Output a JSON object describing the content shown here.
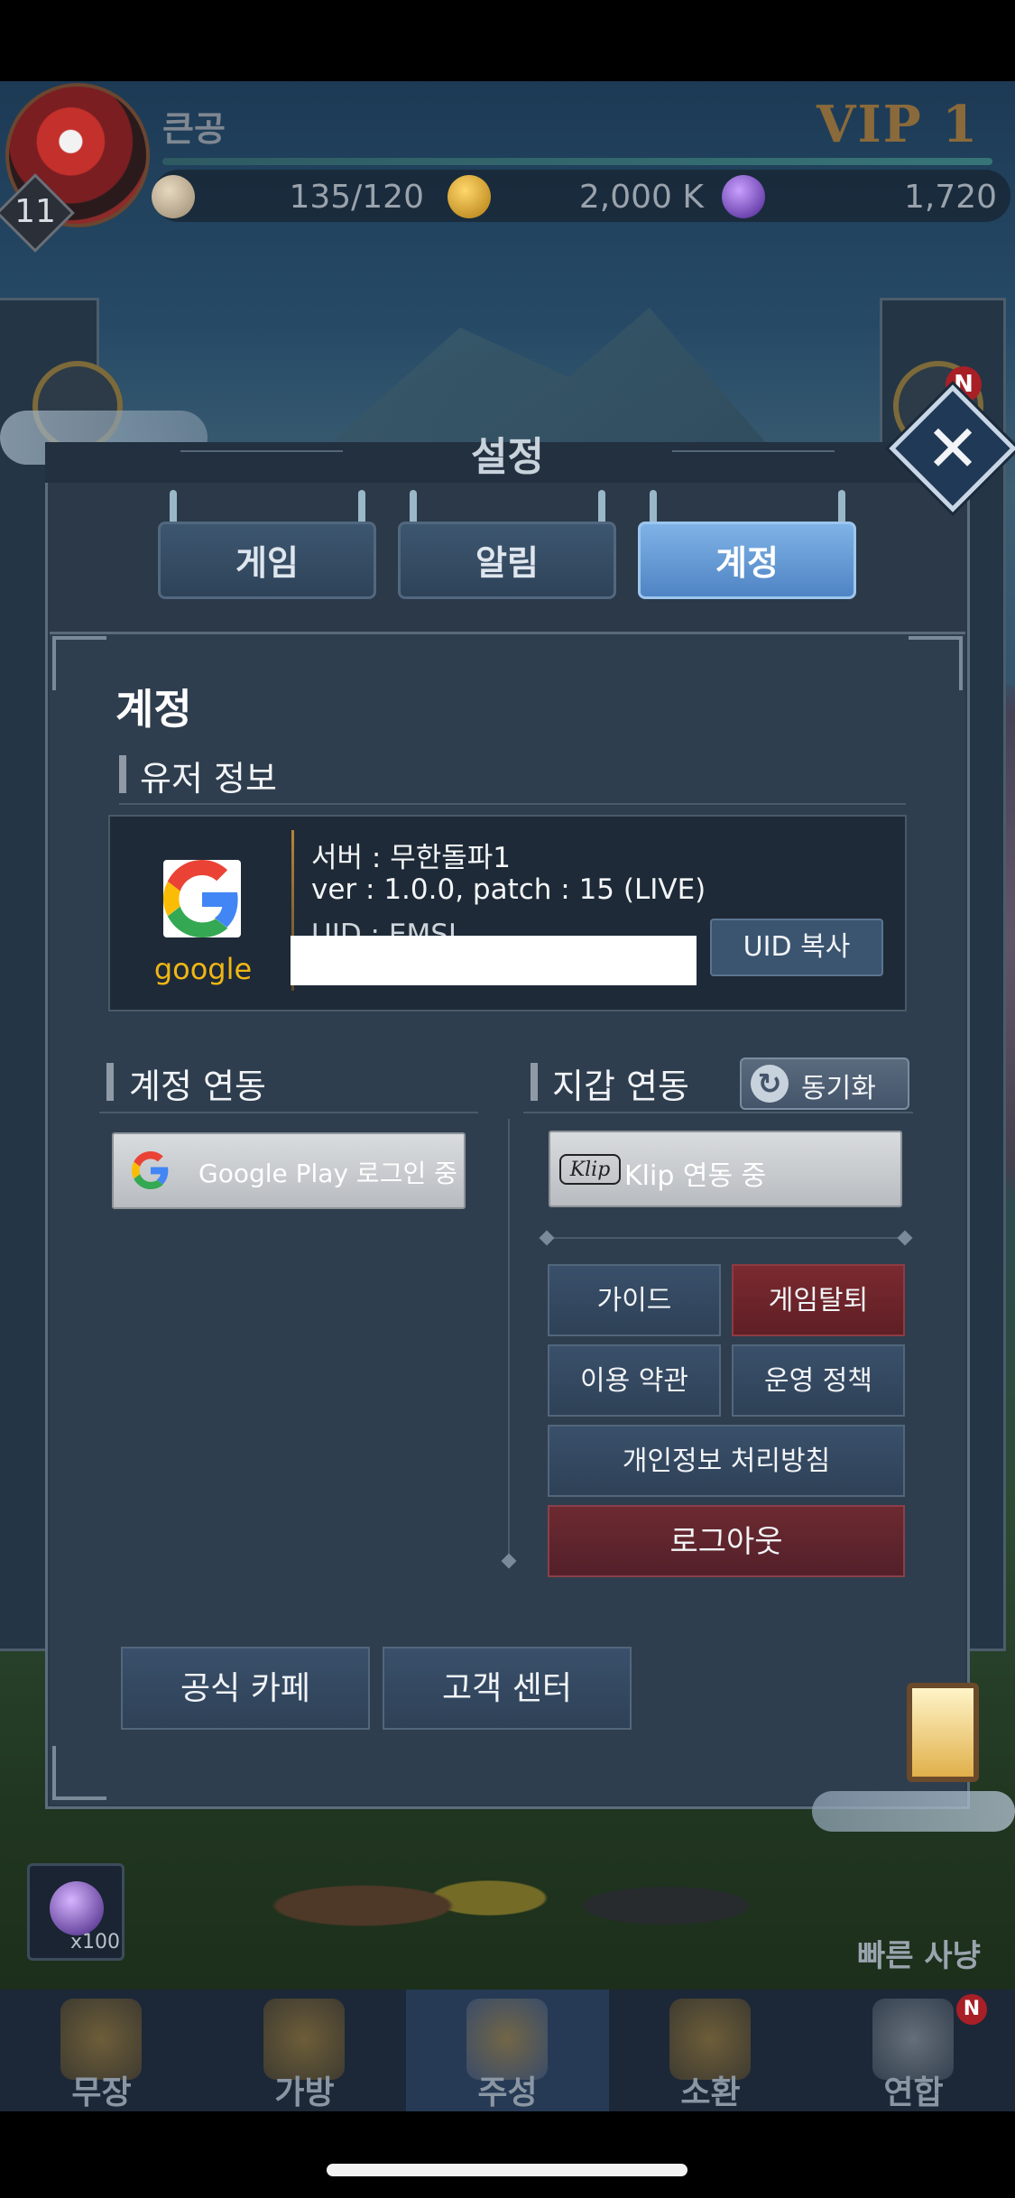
{
  "status": {
    "player_name": "큰공",
    "level": "11",
    "vip": "VIP  1",
    "stamina": "135/120",
    "gold": "2,000 K",
    "gems": "1,720"
  },
  "settings": {
    "title": "설정",
    "close_icon": "✕",
    "tabs": [
      {
        "label": "게임",
        "selected": false
      },
      {
        "label": "알림",
        "selected": false
      },
      {
        "label": "계정",
        "selected": true
      }
    ]
  },
  "account": {
    "section_title": "계정",
    "user_info_title": "유저 정보",
    "provider_label": "google",
    "server": "서버 : 무한돌파1",
    "version": "ver : 1.0.0, patch : 15 (LIVE)",
    "uid_prefix": "UID : EMSI...",
    "uid_copy_label": "UID 복사",
    "account_link_title": "계정 연동",
    "google_play_label": "Google Play 로그인 중",
    "wallet_link_title": "지갑 연동",
    "sync_label": "동기화",
    "klip_logo": "Klip",
    "klip_label": "Klip 연동 중",
    "guide_label": "가이드",
    "withdraw_label": "게임탈퇴",
    "terms_label": "이용 약관",
    "policy_label": "운영 정책",
    "privacy_label": "개인정보 처리방침",
    "logout_label": "로그아웃",
    "cafe_label": "공식 카페",
    "support_label": "고객 센터"
  },
  "game_hud": {
    "item_count": "x100",
    "quick_hunt_label": "빠른 사냥",
    "new_badge": "N"
  },
  "bottom_nav": {
    "items": [
      {
        "label": "무장",
        "icon": "general-icon"
      },
      {
        "label": "가방",
        "icon": "bag-icon"
      },
      {
        "label": "주성",
        "icon": "castle-icon",
        "selected": true
      },
      {
        "label": "소환",
        "icon": "summon-icon"
      },
      {
        "label": "연합",
        "icon": "alliance-icon"
      }
    ]
  },
  "colors": {
    "tab_selected": "#5f94d4",
    "withdraw_button": "#6e262c",
    "google_label": "#f0b616"
  }
}
